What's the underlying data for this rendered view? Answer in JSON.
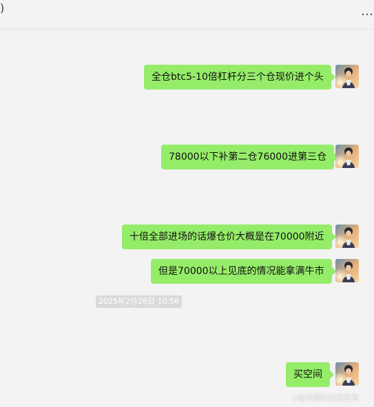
{
  "header": {
    "title_fragment": ")",
    "more_icon": "ellipsis-icon",
    "more_glyph": "…"
  },
  "messages": [
    {
      "text": "全仓btc5-10倍杠杆分三个仓现价进个头"
    },
    {
      "text": "78000以下补第二仓76000进第三仓"
    },
    {
      "text": "十倍全部进场的话爆仓价大概是在70000附近"
    },
    {
      "text": "但是70000以上见底的情况能拿满牛市"
    },
    {
      "text": "买空间"
    }
  ],
  "timestamp": "2025年2月28日 10:56",
  "watermark": "◇@天哥的交易生活",
  "colors": {
    "bubble": "#95ec69",
    "background": "#f3f3f3"
  }
}
